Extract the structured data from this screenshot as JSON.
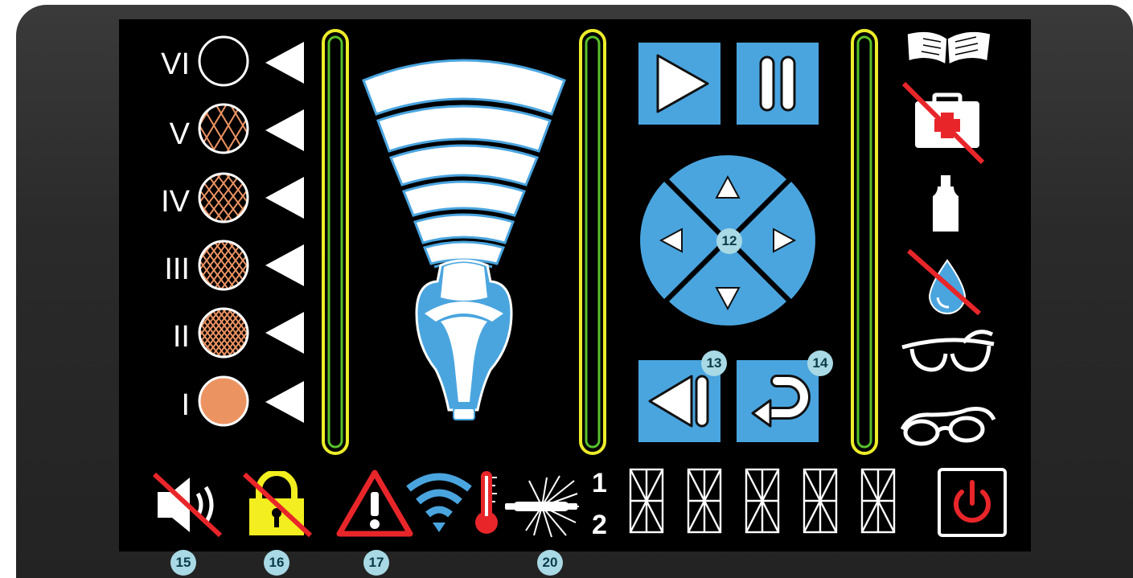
{
  "skin_types": [
    {
      "label": "VI",
      "fill": "#000000",
      "hatch": "none"
    },
    {
      "label": "V",
      "fill": "#000000",
      "hatch": "sparse"
    },
    {
      "label": "IV",
      "fill": "#000000",
      "hatch": "medium"
    },
    {
      "label": "III",
      "fill": "#000000",
      "hatch": "dense"
    },
    {
      "label": "II",
      "fill": "#000000",
      "hatch": "denser"
    },
    {
      "label": "I",
      "fill": "#ec9362",
      "hatch": "solid"
    }
  ],
  "callouts": {
    "dpad": "12",
    "back": "13",
    "return": "14",
    "sound": "15",
    "lock": "16",
    "warning": "17",
    "lamp": "20"
  },
  "lamp_numbers": [
    "1",
    "2"
  ],
  "colors": {
    "accent_blue": "#4aa5df",
    "skin_orange": "#ec9362",
    "bar_yellow": "#ecec2a",
    "bar_green": "#58c02c",
    "alert_red": "#e8262a",
    "lock_yellow": "#f2ee1f",
    "callout_bg": "#a8d9e4"
  },
  "icons": {
    "controls": [
      "play-icon",
      "pause-icon",
      "arrow-up-icon",
      "arrow-left-icon",
      "arrow-right-icon",
      "arrow-down-icon",
      "back-icon",
      "return-icon"
    ],
    "right_column": [
      "manual-book-icon",
      "no-first-aid-icon",
      "bottle-icon",
      "no-water-drop-icon",
      "safety-glasses-icon",
      "goggles-icon"
    ],
    "status": [
      "mute-speaker-icon",
      "unlock-icon",
      "warning-icon",
      "wifi-icon",
      "thermometer-icon",
      "lamp-flash-icon",
      "power-icon"
    ]
  }
}
